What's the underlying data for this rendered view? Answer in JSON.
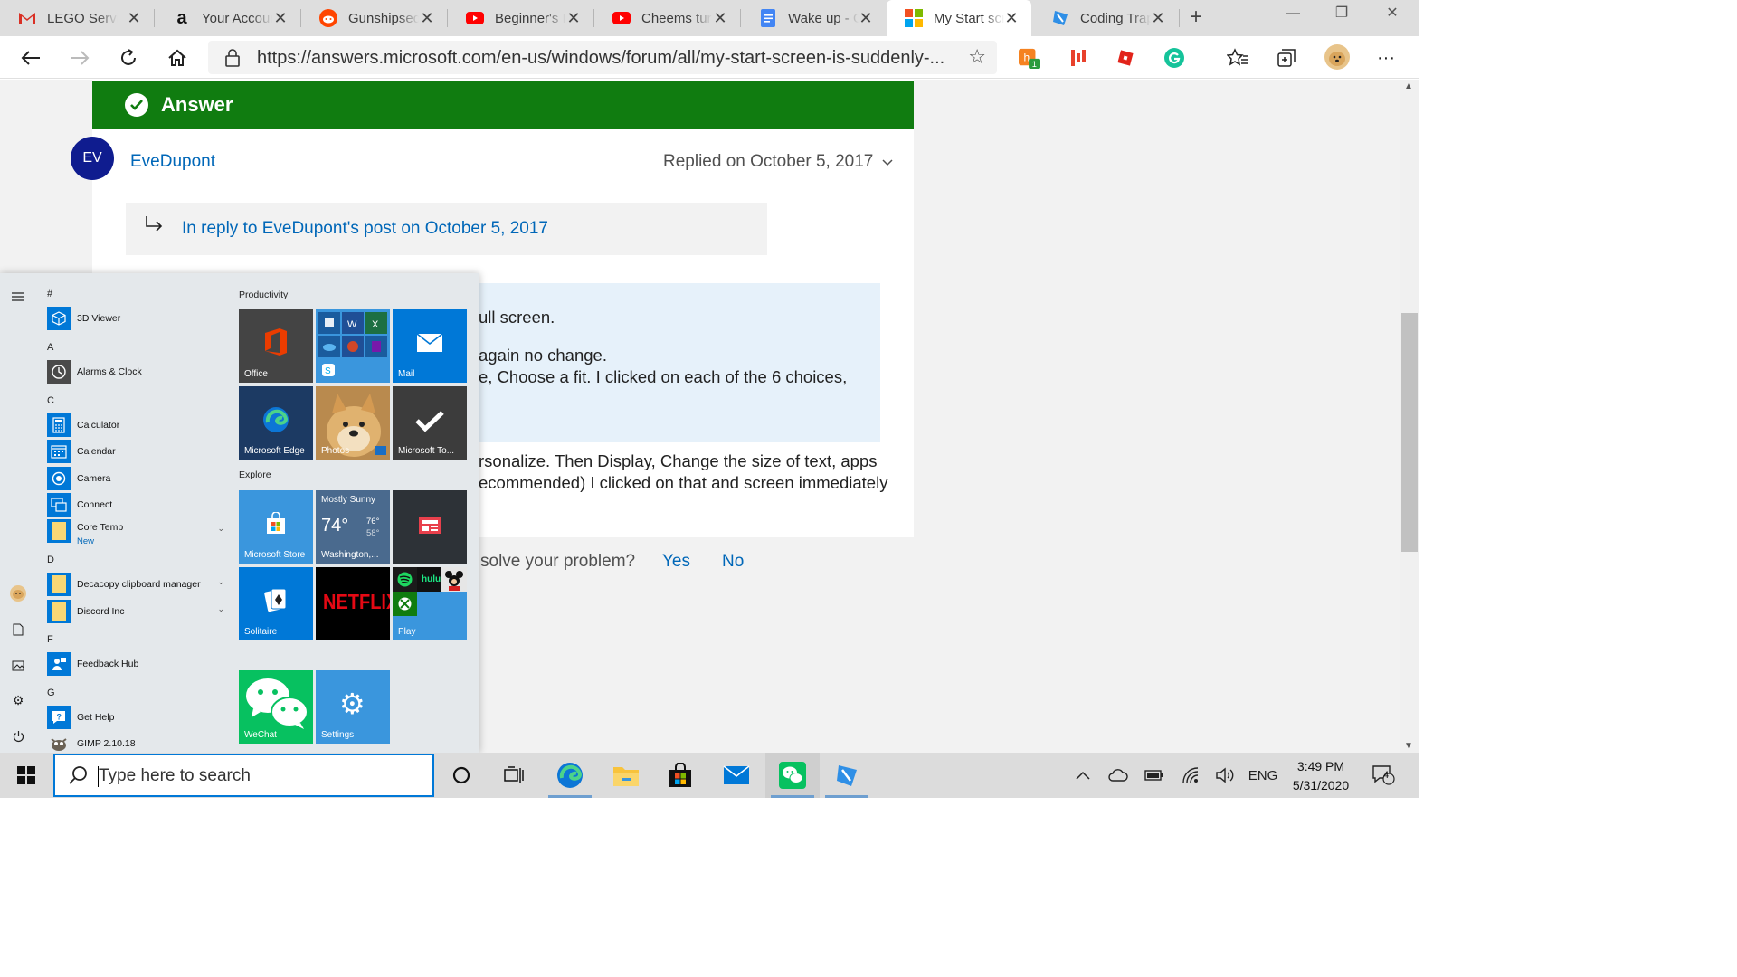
{
  "browser": {
    "tabs": [
      {
        "title": "LEGO Service",
        "icon": "gmail-icon"
      },
      {
        "title": "Your Account",
        "icon": "amazon-icon"
      },
      {
        "title": "Gunshipsequel",
        "icon": "reddit-icon"
      },
      {
        "title": "Beginner's R",
        "icon": "youtube-icon"
      },
      {
        "title": "Cheems turn",
        "icon": "youtube-icon"
      },
      {
        "title": "Wake up - G",
        "icon": "google-docs-icon"
      },
      {
        "title": "My Start scre",
        "icon": "microsoft-icon",
        "active": true
      },
      {
        "title": "Coding Trap",
        "icon": "coding-trap-icon"
      }
    ],
    "url": "https://answers.microsoft.com/en-us/windows/forum/all/my-start-screen-is-suddenly-...",
    "extension_badge": "1"
  },
  "post": {
    "answer_label": "Answer",
    "avatar_initials": "EV",
    "author": "EveDupont",
    "replied": "Replied on October 5, 2017",
    "reply_link": "In reply to EveDupont's post on October 5, 2017",
    "quote_lines": [
      "ull screen.",
      "again no change.",
      "e, Choose a fit. I clicked on each of the 6 choices,"
    ],
    "body_lines": [
      "rsonalize. Then Display, Change the size of text, apps",
      "ecommended) I clicked on that and screen immediately"
    ],
    "helpful_question": "solve your problem?",
    "yes": "Yes",
    "no": "No"
  },
  "start_menu": {
    "apps": [
      {
        "type": "letter",
        "text": "#"
      },
      {
        "type": "app",
        "name": "3D Viewer"
      },
      {
        "type": "letter",
        "text": "A"
      },
      {
        "type": "app",
        "name": "Alarms & Clock"
      },
      {
        "type": "letter",
        "text": "C"
      },
      {
        "type": "app",
        "name": "Calculator"
      },
      {
        "type": "app",
        "name": "Calendar"
      },
      {
        "type": "app",
        "name": "Camera"
      },
      {
        "type": "app",
        "name": "Connect"
      },
      {
        "type": "app",
        "name": "Core Temp",
        "sub": "New"
      },
      {
        "type": "letter",
        "text": "D"
      },
      {
        "type": "app",
        "name": "Decacopy clipboard manager"
      },
      {
        "type": "app",
        "name": "Discord Inc"
      },
      {
        "type": "letter",
        "text": "F"
      },
      {
        "type": "app",
        "name": "Feedback Hub"
      },
      {
        "type": "letter",
        "text": "G"
      },
      {
        "type": "app",
        "name": "Get Help"
      },
      {
        "type": "app",
        "name": "GIMP 2.10.18"
      }
    ],
    "groups": {
      "productivity": "Productivity",
      "explore": "Explore"
    },
    "tiles": {
      "office": "Office",
      "mail": "Mail",
      "edge": "Microsoft Edge",
      "photos": "Photos",
      "todo": "Microsoft To...",
      "store": "Microsoft Store",
      "weather_condition": "Mostly Sunny",
      "weather_temp": "74°",
      "weather_high": "76°",
      "weather_low": "58°",
      "weather_location": "Washington,...",
      "solitaire": "Solitaire",
      "netflix": "NETFLIX",
      "play": "Play",
      "hulu": "hulu",
      "wechat": "WeChat",
      "settings": "Settings"
    }
  },
  "taskbar": {
    "search_placeholder": "Type here to search",
    "language": "ENG",
    "time": "3:49 PM",
    "date": "5/31/2020",
    "notification_count": "4"
  },
  "colors": {
    "answer_green": "#107c10",
    "link_blue": "#0067b8",
    "avatar_navy": "#0f1c8f",
    "tile_blue": "#3a96dd"
  }
}
